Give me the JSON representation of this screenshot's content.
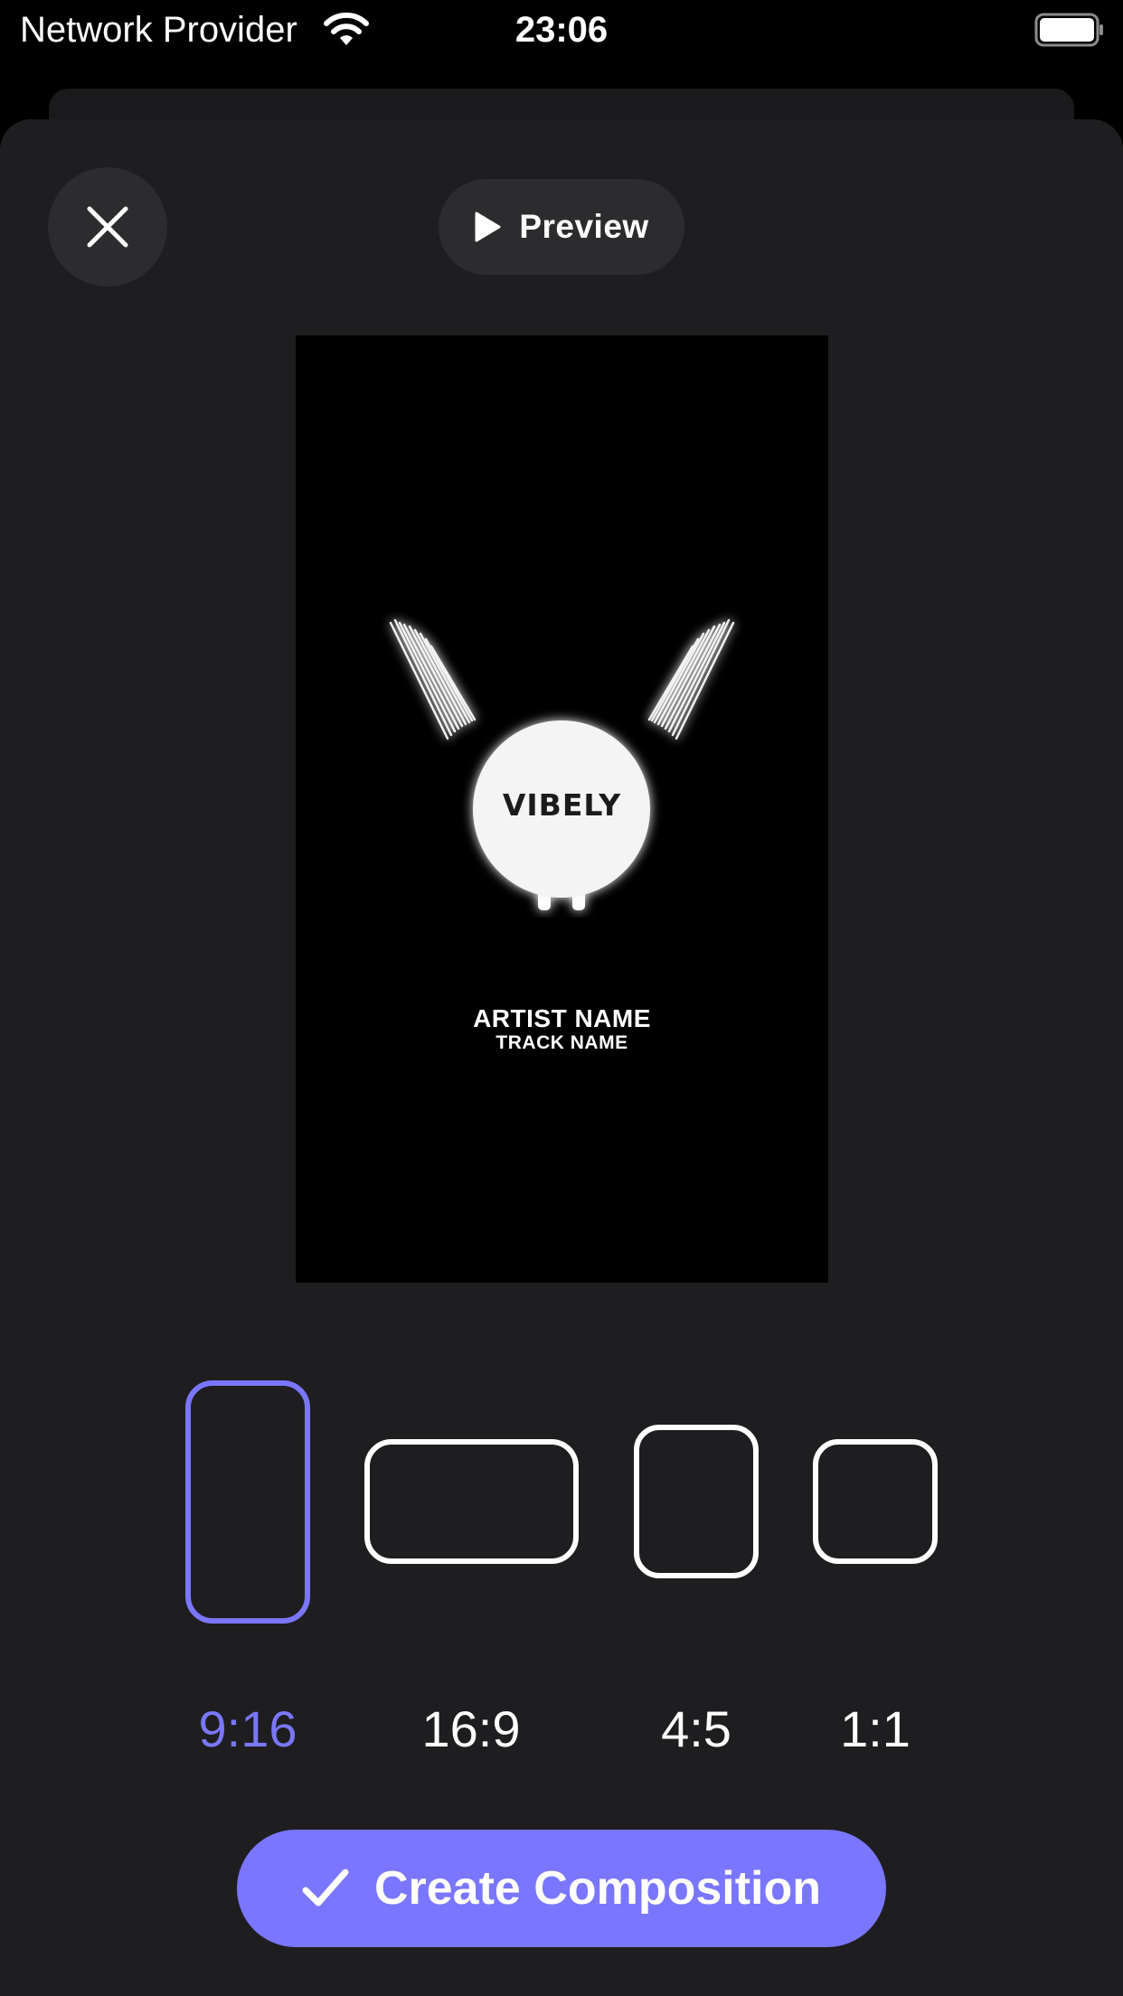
{
  "status_bar": {
    "carrier": "Network Provider",
    "time": "23:06"
  },
  "toolbar": {
    "close_icon": "close-icon",
    "preview_label": "Preview",
    "preview_icon": "play-icon"
  },
  "canvas": {
    "logo_text": "VIBELY",
    "artist": "ARTIST NAME",
    "track": "TRACK NAME"
  },
  "aspect_ratios": {
    "selected": "9:16",
    "options": [
      {
        "label": "9:16"
      },
      {
        "label": "16:9"
      },
      {
        "label": "4:5"
      },
      {
        "label": "1:1"
      }
    ]
  },
  "actions": {
    "create_label": "Create Composition",
    "create_icon": "checkmark-icon"
  },
  "colors": {
    "accent": "#7a76ff",
    "sheet_background": "#1e1e20",
    "button_background": "#2c2c2e",
    "canvas_background": "#000000"
  }
}
